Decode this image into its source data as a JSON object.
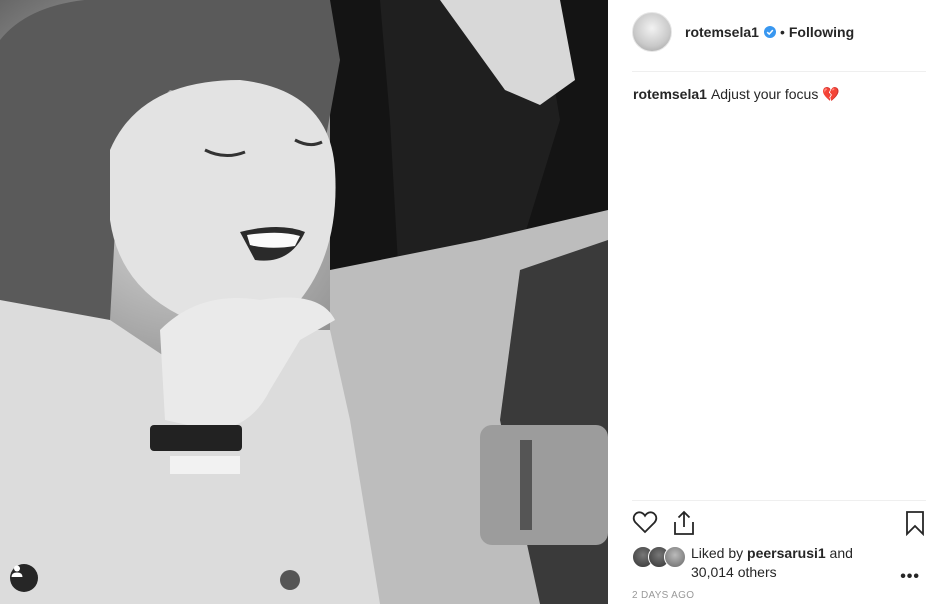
{
  "post": {
    "user_tag_icon": "user-silhouette-icon"
  },
  "header": {
    "username": "rotemsela1",
    "verified_icon": "verified-badge-icon",
    "separator": "•",
    "follow_status": "Following"
  },
  "caption": {
    "username": "rotemsela1",
    "text": "Adjust your focus 💔"
  },
  "actions": {
    "like_icon": "heart-outline-icon",
    "share_icon": "share-upload-icon",
    "save_icon": "bookmark-icon"
  },
  "likes": {
    "prefix": "Liked by",
    "user": "peersarusi1",
    "and": "and",
    "others": "30,014 others"
  },
  "more_label": "•••",
  "timestamp": "2 DAYS AGO",
  "colors": {
    "verified_blue": "#3897f0",
    "text": "#262626",
    "muted": "#999999"
  }
}
